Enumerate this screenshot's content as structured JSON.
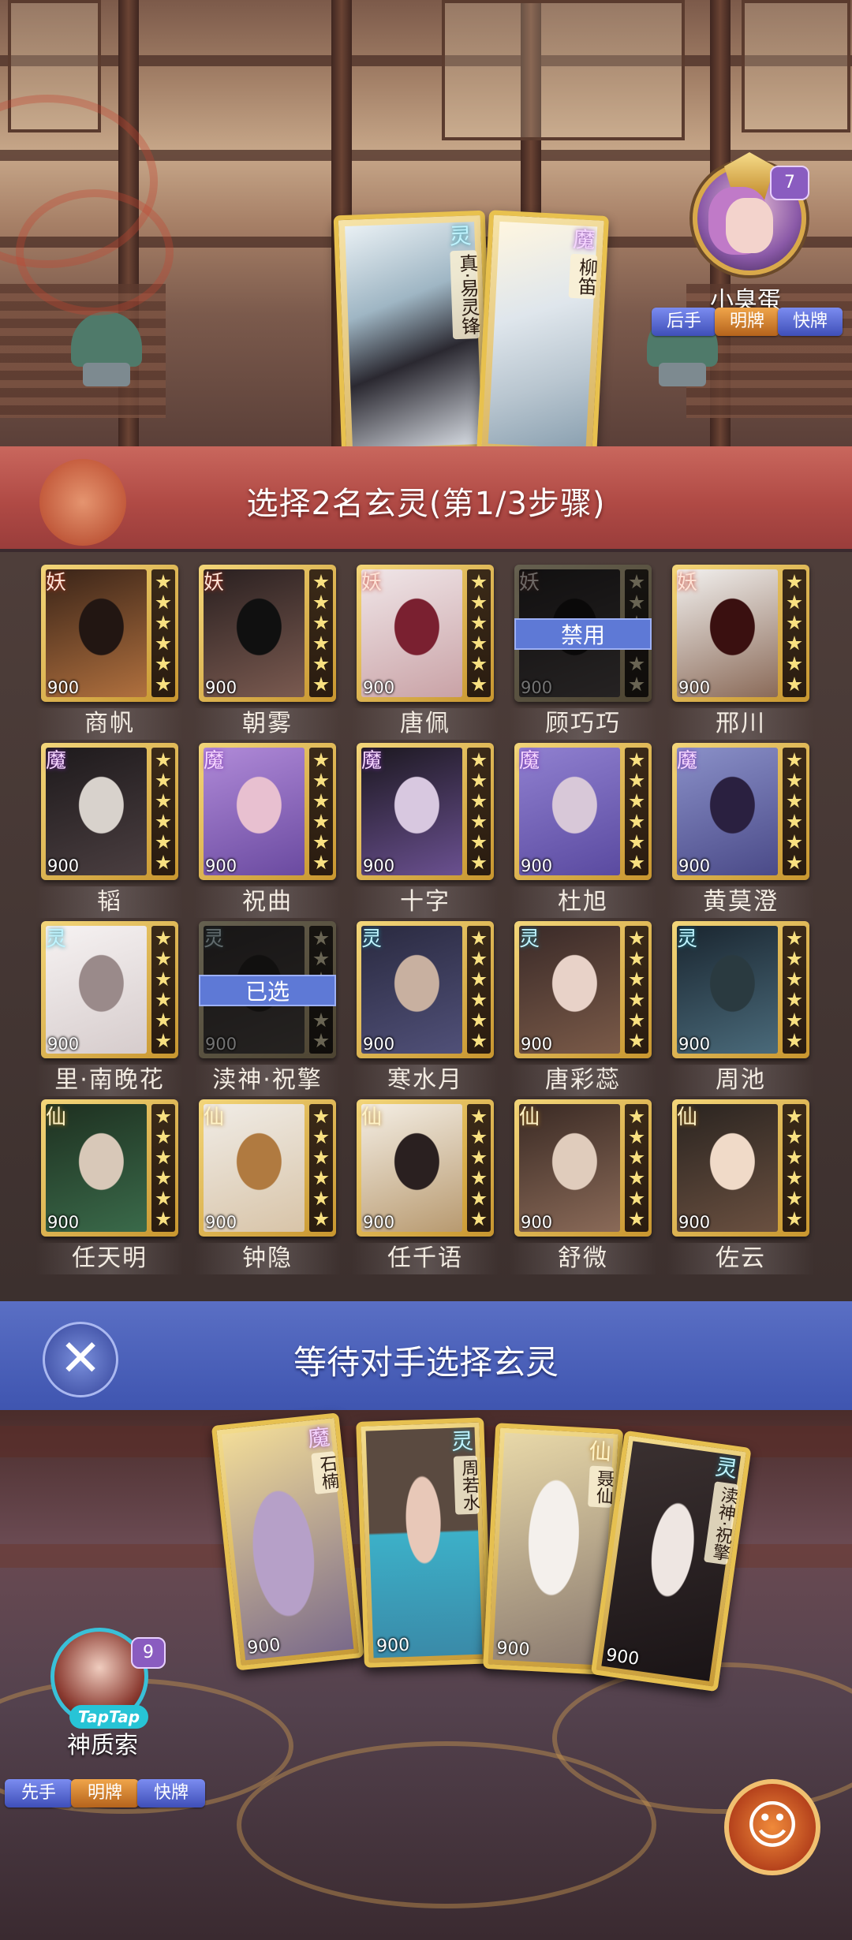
{
  "opponent": {
    "name": "小臭蛋",
    "level": "7",
    "tags": [
      "后手",
      "明牌",
      "快牌"
    ]
  },
  "top_cards": [
    {
      "faction": "灵",
      "name": "真·易灵锋"
    },
    {
      "faction": "魔",
      "name": "柳笛"
    }
  ],
  "banner": {
    "text": "选择2名玄灵(第1/3步骤)"
  },
  "grid": [
    {
      "faction": "妖",
      "cost": "900",
      "name": "商帆",
      "status": ""
    },
    {
      "faction": "妖",
      "cost": "900",
      "name": "朝雾",
      "status": ""
    },
    {
      "faction": "妖",
      "cost": "900",
      "name": "唐佩",
      "status": ""
    },
    {
      "faction": "妖",
      "cost": "900",
      "name": "顾巧巧",
      "status": "禁用"
    },
    {
      "faction": "妖",
      "cost": "900",
      "name": "邢川",
      "status": ""
    },
    {
      "faction": "魔",
      "cost": "900",
      "name": "韬",
      "status": ""
    },
    {
      "faction": "魔",
      "cost": "900",
      "name": "祝曲",
      "status": ""
    },
    {
      "faction": "魔",
      "cost": "900",
      "name": "十字",
      "status": ""
    },
    {
      "faction": "魔",
      "cost": "900",
      "name": "杜旭",
      "status": ""
    },
    {
      "faction": "魔",
      "cost": "900",
      "name": "黄莫澄",
      "status": ""
    },
    {
      "faction": "灵",
      "cost": "900",
      "name": "里·南晚花",
      "status": ""
    },
    {
      "faction": "灵",
      "cost": "900",
      "name": "渎神·祝擎",
      "status": "已选"
    },
    {
      "faction": "灵",
      "cost": "900",
      "name": "寒水月",
      "status": ""
    },
    {
      "faction": "灵",
      "cost": "900",
      "name": "唐彩蕊",
      "status": ""
    },
    {
      "faction": "灵",
      "cost": "900",
      "name": "周池",
      "status": ""
    },
    {
      "faction": "仙",
      "cost": "900",
      "name": "任天明",
      "status": ""
    },
    {
      "faction": "仙",
      "cost": "900",
      "name": "钟隐",
      "status": ""
    },
    {
      "faction": "仙",
      "cost": "900",
      "name": "任千语",
      "status": ""
    },
    {
      "faction": "仙",
      "cost": "900",
      "name": "舒微",
      "status": ""
    },
    {
      "faction": "仙",
      "cost": "900",
      "name": "佐云",
      "status": ""
    }
  ],
  "waiting": {
    "text": "等待对手选择玄灵",
    "close_icon": "✕"
  },
  "hand_cards": [
    {
      "faction": "魔",
      "name": "石楠",
      "cost": "900"
    },
    {
      "faction": "灵",
      "name": "周若水",
      "cost": "900"
    },
    {
      "faction": "仙",
      "name": "聂仙",
      "cost": "900"
    },
    {
      "faction": "灵",
      "name": "渎神·祝擎",
      "cost": "900"
    }
  ],
  "player": {
    "name": "神质索",
    "level": "9",
    "badge": "TapTap",
    "tags": [
      "先手",
      "明牌",
      "快牌"
    ]
  },
  "emoji_button": {
    "icon": "☺"
  },
  "colors": {
    "banner": "#b04a45",
    "wait_bar": "#4a5fbc",
    "gold": "#e8c14e",
    "overlay": "#5e79d6"
  }
}
